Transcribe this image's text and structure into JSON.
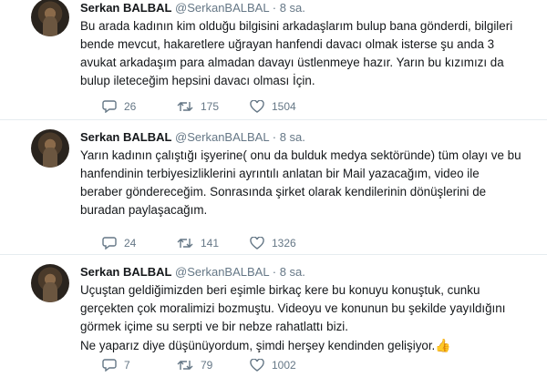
{
  "tweets": [
    {
      "name": "Serkan BALBAL",
      "handle": "@SerkanBALBAL",
      "time": "8 sa.",
      "lines": [
        "Bu arada kadının kim olduğu bilgisini arkadaşlarım bulup bana gönderdi, bilgileri",
        "bende mevcut, hakaretlere uğrayan hanfendi davacı olmak isterse şu anda 3",
        "avukat arkadaşım para almadan davayı üstlenmeye hazır. Yarın bu kızımızı da",
        "bulup ileteceğim hepsini davacı olması İçin."
      ],
      "replies": "26",
      "retweets": "175",
      "likes": "1504"
    },
    {
      "name": "Serkan BALBAL",
      "handle": "@SerkanBALBAL",
      "time": "8 sa.",
      "lines": [
        "Yarın kadının çalıştığı işyerine( onu da bulduk medya sektöründe) tüm olayı ve bu",
        "hanfendinin terbiyesizliklerini ayrıntılı anlatan bir Mail yazacağım, video ile",
        "beraber göndereceğim. Sonrasında şirket olarak kendilerinin dönüşlerini de",
        "buradan paylaşacağım."
      ],
      "replies": "24",
      "retweets": "141",
      "likes": "1326"
    },
    {
      "name": "Serkan BALBAL",
      "handle": "@SerkanBALBAL",
      "time": "8 sa.",
      "lines": [
        "Uçuştan geldiğimizden beri eşimle birkaç kere bu konuyu konuştuk, cunku",
        "gerçekten çok moralimizi bozmuştu. Videoyu ve konunun bu şekilde yayıldığını",
        "görmek içime su serpti ve bir nebze rahatlattı bizi.",
        "Ne yaparız diye düşünüyordum, şimdi herşey kendinden gelişiyor."
      ],
      "emoji": "👍",
      "replies": "7",
      "retweets": "79",
      "likes": "1002"
    }
  ],
  "colors": {
    "text": "#14171a",
    "secondary": "#657786",
    "divider": "#e6ecf0"
  },
  "icons": [
    "reply-icon",
    "retweet-icon",
    "like-icon",
    "thumbs-up-emoji"
  ]
}
